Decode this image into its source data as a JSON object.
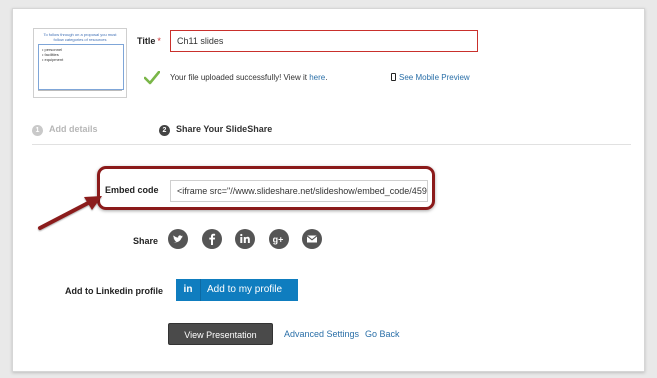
{
  "thumbnail": {
    "slide_title": "To follow through on a proposal you must follow categories of resources",
    "bullets": [
      "personnel",
      "facilities",
      "equipment"
    ]
  },
  "form": {
    "title_label": "Title",
    "required_mark": "*",
    "title_value": "Ch11 slides",
    "upload_message": "Your file uploaded successfully! View it",
    "upload_link": "here",
    "upload_period": ".",
    "mobile_preview": "See Mobile Preview"
  },
  "steps": [
    {
      "number": "1",
      "label": "Add details"
    },
    {
      "number": "2",
      "label": "Share Your SlideShare"
    }
  ],
  "embed": {
    "label": "Embed code",
    "value": "<iframe src=\"//www.slideshare.net/slideshow/embed_code/459"
  },
  "share": {
    "label": "Share",
    "networks": [
      "twitter-icon",
      "facebook-icon",
      "linkedin-icon",
      "google-plus-icon",
      "email-icon"
    ]
  },
  "linkedin_profile": {
    "label": "Add to Linkedin profile",
    "button_mark": "in",
    "button_text": "Add to my profile"
  },
  "actions": {
    "view_presentation": "View Presentation",
    "advanced_settings": "Advanced Settings",
    "go_back": "Go Back"
  },
  "colors": {
    "error_border": "#c9302c",
    "link": "#2a6fa8",
    "linkedin_blue": "#0f7dbf",
    "highlight": "#8b1a1a",
    "success_check": "#7ab648"
  }
}
